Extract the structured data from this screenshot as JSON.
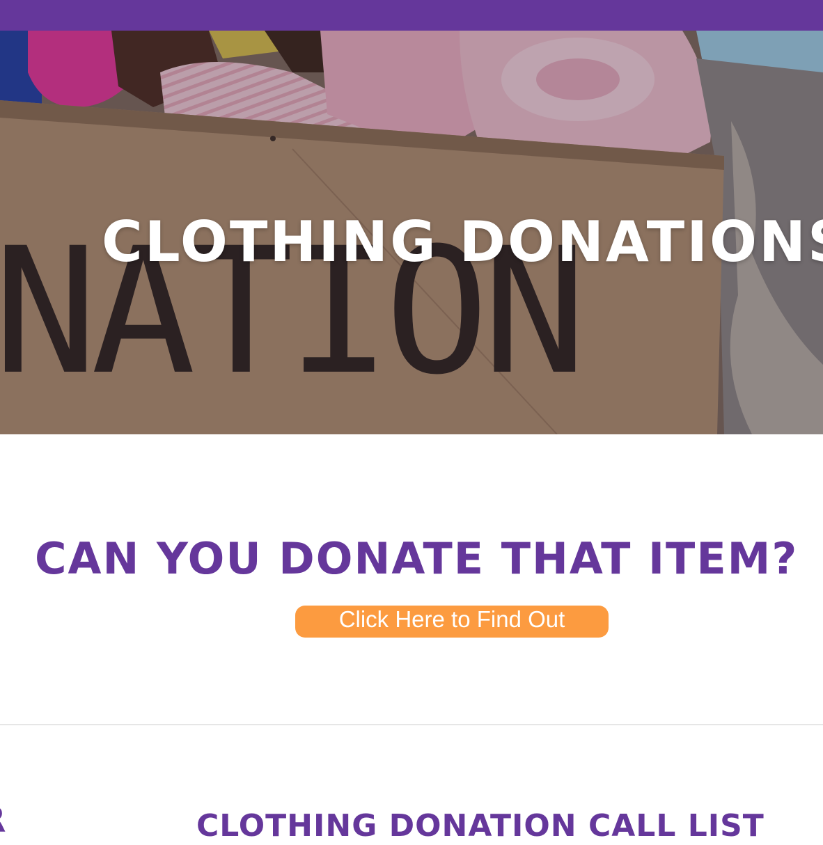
{
  "header": {
    "bar_color": "#65379b"
  },
  "hero": {
    "title": "CLOTHING DONATIONS",
    "image_icon": "donation-box-photo",
    "image_text": "NATION"
  },
  "main": {
    "question": "CAN YOU DONATE THAT ITEM?",
    "cta_label": "Click Here to Find Out",
    "accent_color": "#65379b",
    "button_color": "#fc9b40"
  },
  "next_section": {
    "left_heading_fragment": "R",
    "call_list_heading": "CLOTHING DONATION CALL LIST"
  }
}
